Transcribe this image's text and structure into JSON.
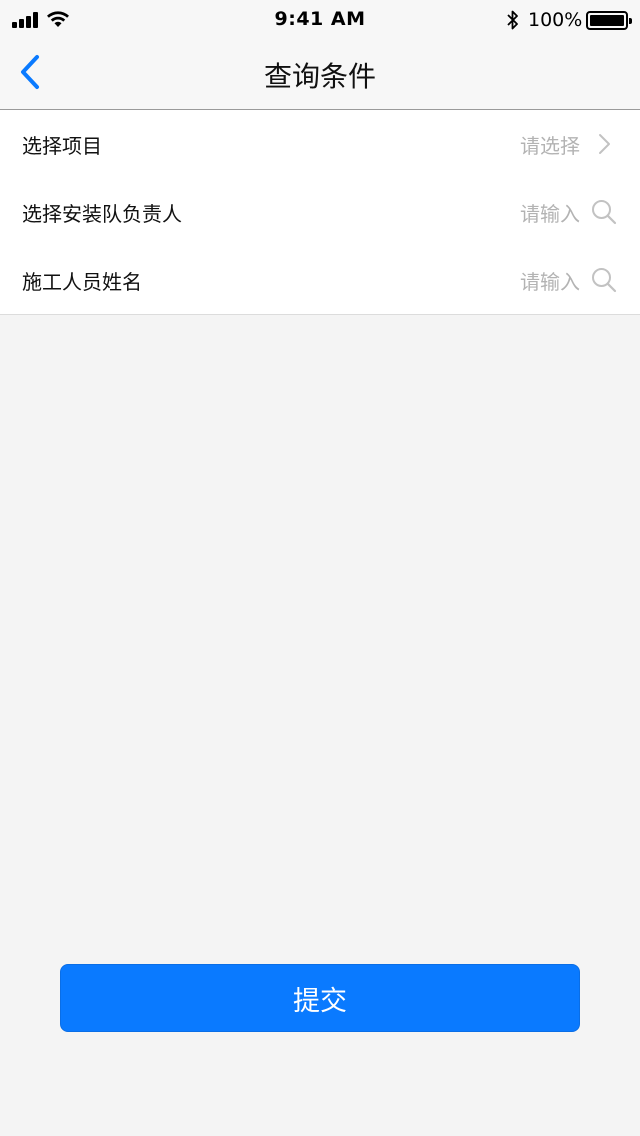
{
  "status_bar": {
    "time": "9:41 AM",
    "battery_percent": "100%",
    "battery_level": 1.0
  },
  "nav": {
    "title": "查询条件",
    "back_icon": "chevron-left-icon",
    "accent_color": "#0a7aff"
  },
  "form": {
    "rows": [
      {
        "label": "选择项目",
        "placeholder": "请选择",
        "icon": "chevron-right-icon"
      },
      {
        "label": "选择安装队负责人",
        "placeholder": "请输入",
        "icon": "search-icon"
      },
      {
        "label": "施工人员姓名",
        "placeholder": "请输入",
        "icon": "search-icon"
      }
    ]
  },
  "submit": {
    "label": "提交",
    "color": "#0a7aff"
  }
}
